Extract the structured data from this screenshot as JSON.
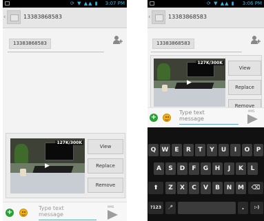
{
  "status_bar": {
    "left_time": "3:07 PM",
    "right_time": "3:06 PM"
  },
  "thread": {
    "title": "13383868583"
  },
  "recipient": {
    "chip": "13383868583"
  },
  "attachment": {
    "size_label": "127K/300K",
    "view_label": "View",
    "replace_label": "Replace",
    "remove_label": "Remove"
  },
  "compose": {
    "placeholder_line1": "Type text",
    "placeholder_line2": "message",
    "mms_label": "MMS"
  },
  "keyboard": {
    "row1": [
      "Q",
      "W",
      "E",
      "R",
      "T",
      "Y",
      "U",
      "I",
      "O",
      "P"
    ],
    "row2": [
      "A",
      "S",
      "D",
      "F",
      "G",
      "H",
      "J",
      "K",
      "L"
    ],
    "row3": [
      "Z",
      "X",
      "C",
      "V",
      "B",
      "N",
      "M"
    ],
    "symbols_label": "?123",
    "mic_label": "🎤",
    "period_label": ".",
    "enter_label": ":-)",
    "shift_label": "⬆",
    "delete_label": "⌫"
  },
  "colors": {
    "accent": "#33b5e5",
    "add_icon": "#27a135"
  }
}
